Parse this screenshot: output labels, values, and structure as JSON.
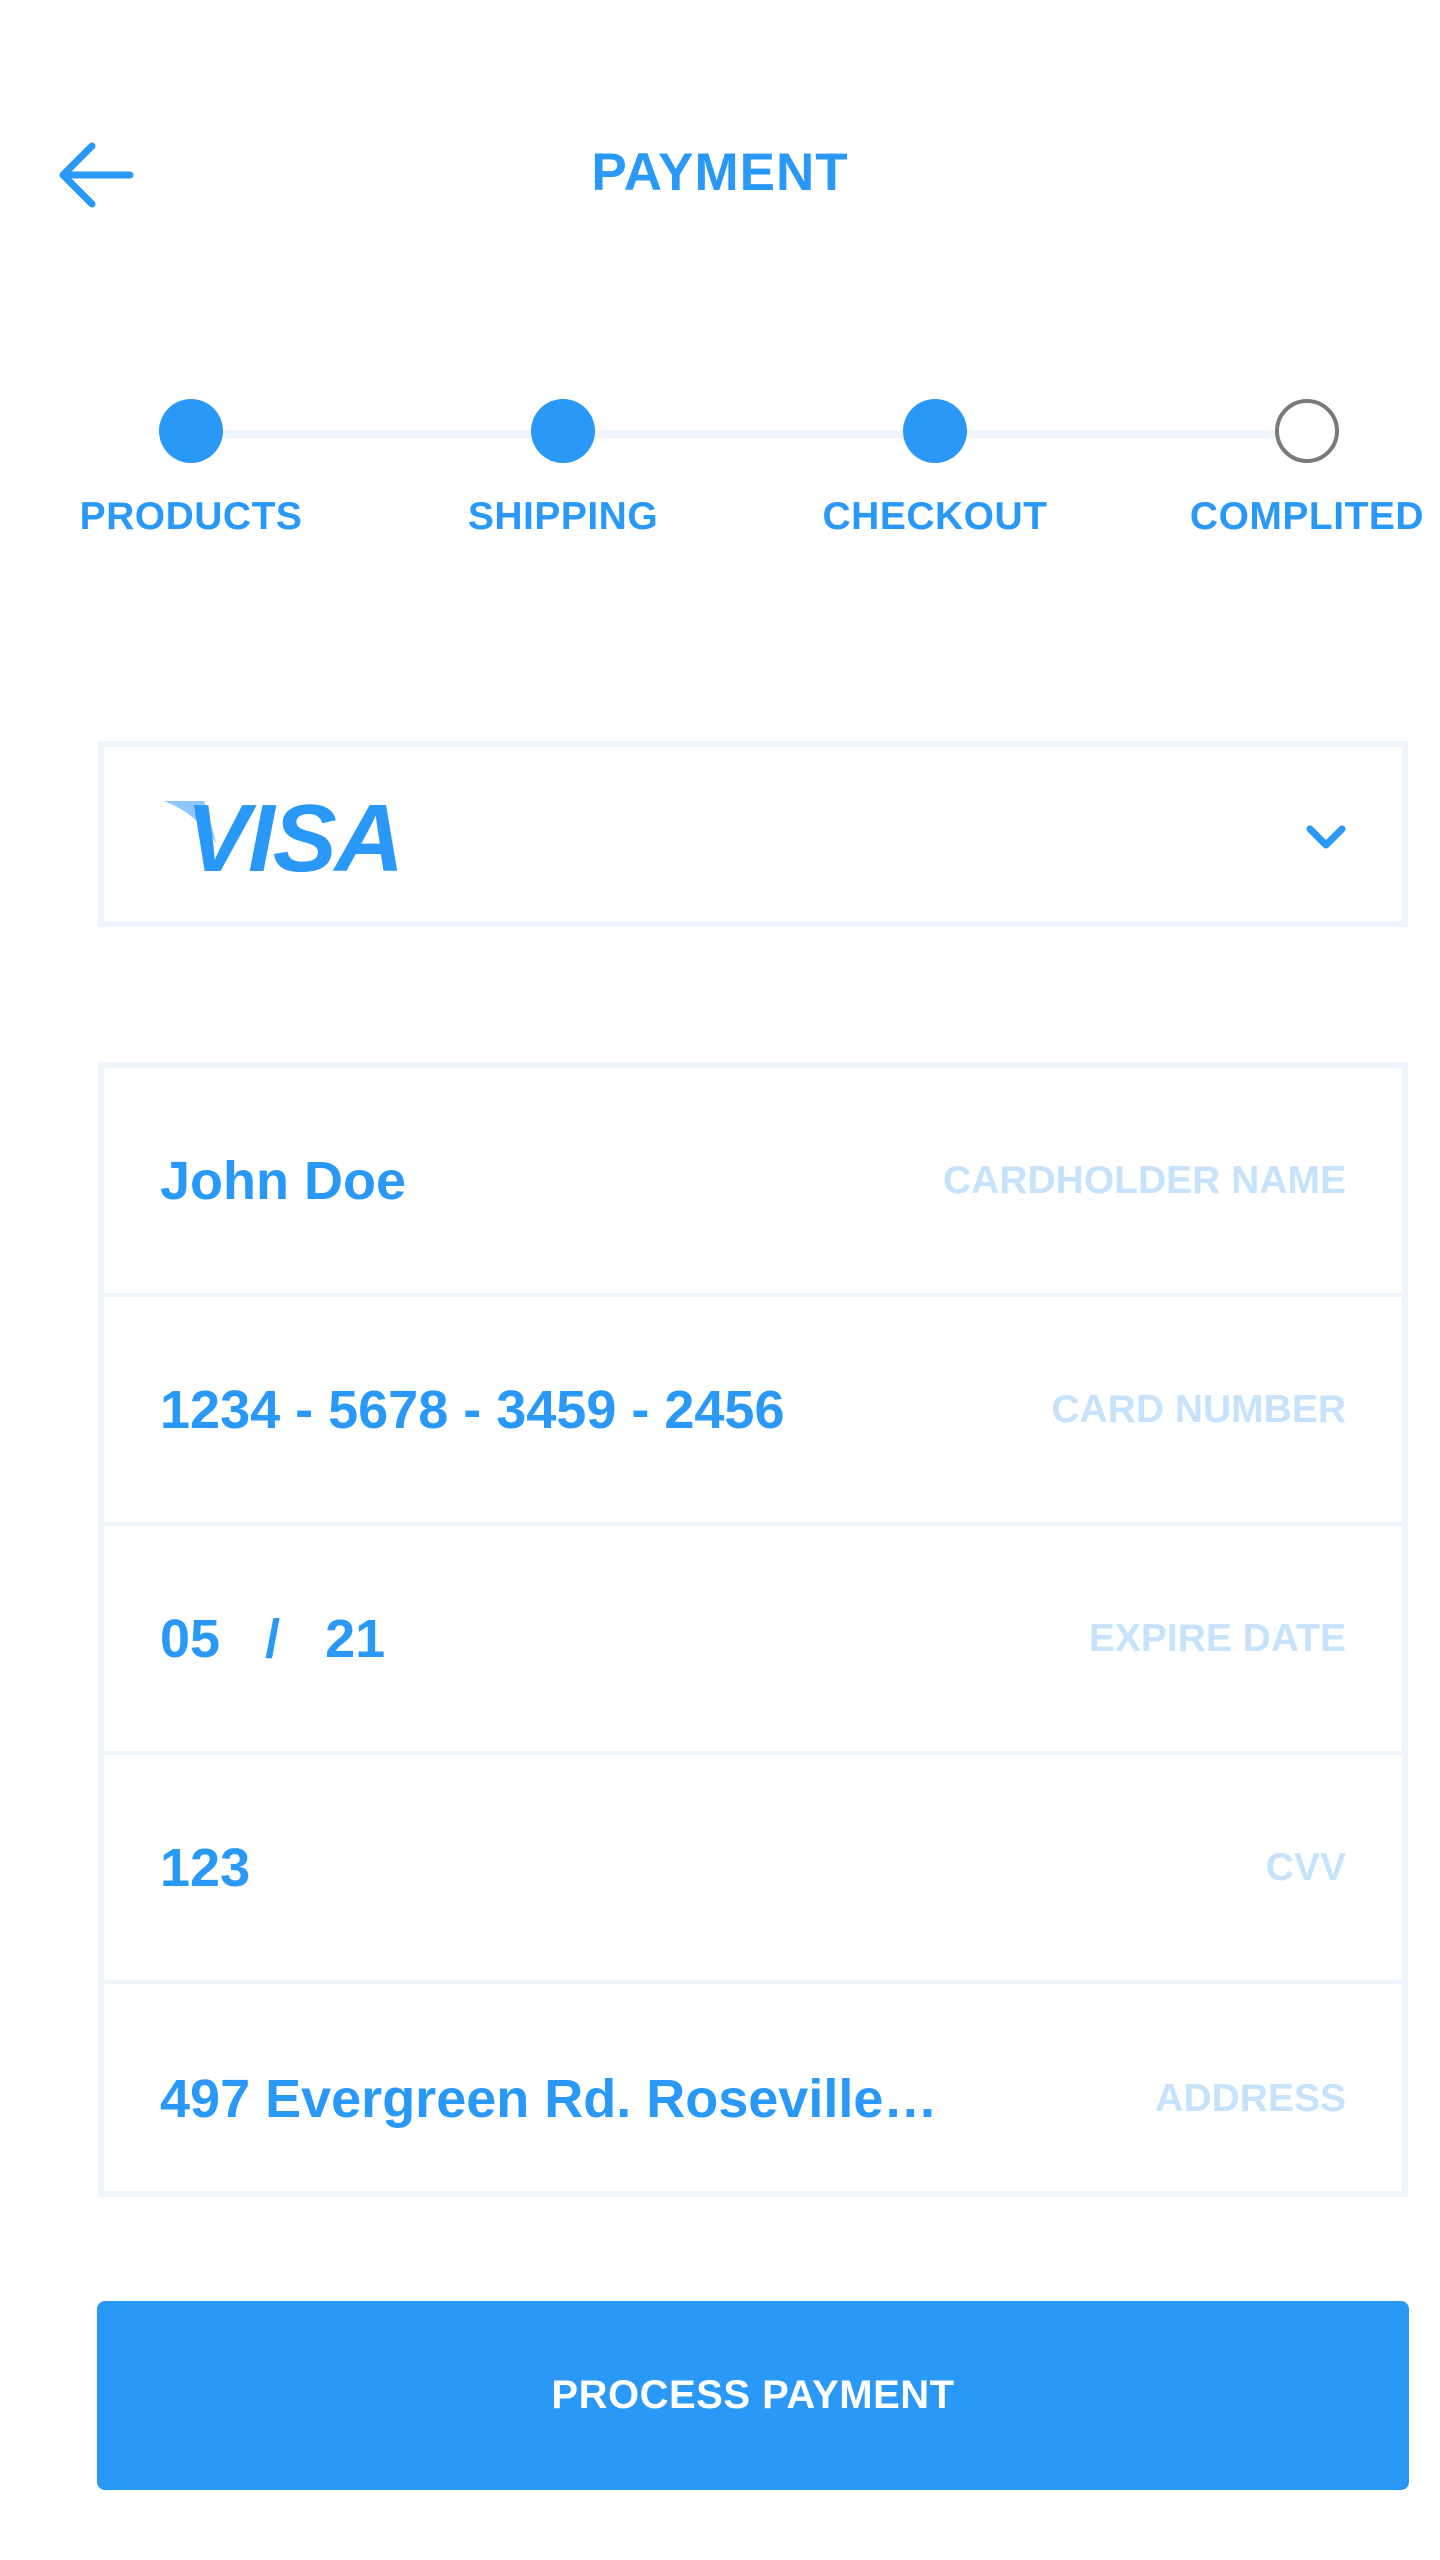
{
  "header": {
    "title": "PAYMENT"
  },
  "stepper": {
    "steps": [
      {
        "label": "PRODUCTS",
        "completed": true
      },
      {
        "label": "SHIPPING",
        "completed": true
      },
      {
        "label": "CHECKOUT",
        "completed": true
      },
      {
        "label": "COMPLITED",
        "completed": false
      }
    ]
  },
  "card_select": {
    "brand": "VISA"
  },
  "form": {
    "cardholder": {
      "value": "John Doe",
      "label": "CARDHOLDER NAME"
    },
    "card_number": {
      "value": "1234 - 5678 - 3459 - 2456",
      "label": "CARD NUMBER"
    },
    "expire": {
      "value": "05   /   21",
      "label": "EXPIRE DATE"
    },
    "cvv": {
      "value": "123",
      "label": "CVV"
    },
    "address": {
      "value": "497 Evergreen Rd. Roseville…",
      "label": "ADDRESS"
    }
  },
  "actions": {
    "process_label": "PROCESS PAYMENT"
  },
  "colors": {
    "accent": "#2a98f6",
    "label_light": "#c7e2fb",
    "border": "#eef5fc",
    "inactive_step": "#7a7a7a"
  }
}
